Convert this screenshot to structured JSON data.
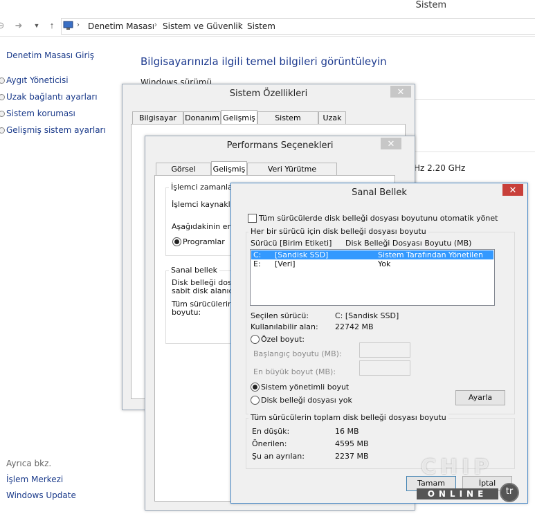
{
  "window": {
    "title": "Sistem"
  },
  "nav": {
    "back_icon": "back-arrow-icon",
    "forward_icon": "forward-arrow-icon",
    "breadcrumb": [
      "Denetim Masası",
      "Sistem ve Güvenlik",
      "Sistem"
    ]
  },
  "sidebar": {
    "home": "Denetim Masası Giriş",
    "items": [
      "Aygıt Yöneticisi",
      "Uzak bağlantı ayarları",
      "Sistem koruması",
      "Gelişmiş sistem ayarları"
    ],
    "see_also": "Ayrıca bkz.",
    "see_also_items": [
      "İşlem Merkezi",
      "Windows Update"
    ]
  },
  "main": {
    "heading": "Bilgisayarınızla ilgili temel bilgileri görüntüleyin",
    "windows_edition": "Windows sürümü",
    "cpu_speed": "Hz  2.20 GHz"
  },
  "sysprops": {
    "title": "Sistem Özellikleri",
    "close": "✕",
    "tabs": [
      "Bilgisayar Adı",
      "Donanım",
      "Gelişmiş",
      "Sistem Koruması",
      "Uzak"
    ],
    "active_tab": 2
  },
  "perf": {
    "title": "Performans Seçenekleri",
    "close": "✕",
    "tabs": [
      "Görsel Efektler",
      "Gelişmiş",
      "Veri Yürütme Engellemesi"
    ],
    "active_tab": 1,
    "sched_group": "İşlemci zamanlama",
    "sched_desc": "İşlemci kaynakların",
    "sched_best": "Aşağıdakinin en iy",
    "programs": "Programlar",
    "vm_group": "Sanal bellek",
    "vm_desc1": "Disk belleği dosyas",
    "vm_desc2": "sabit disk alanıdır.",
    "vm_desc3": "Tüm sürücülerin to",
    "vm_desc4": "boyutu:"
  },
  "vmem": {
    "title": "Sanal Bellek",
    "close": "✕",
    "auto_manage": "Tüm sürücülerde disk belleği dosyası boyutunu otomatik yönet",
    "per_drive_group": "Her bir sürücü için disk belleği dosyası boyutu",
    "col_drive": "Sürücü  [Birim Etiketi]",
    "col_size": "Disk Belleği Dosyası Boyutu (MB)",
    "drives": [
      {
        "letter": "C:",
        "label": "[Sandisk SSD]",
        "size": "Sistem Tarafından Yönetilen"
      },
      {
        "letter": "E:",
        "label": "[Veri]",
        "size": "Yok"
      }
    ],
    "selected_drive_label": "Seçilen sürücü:",
    "selected_drive_value": "C:  [Sandisk SSD]",
    "free_space_label": "Kullanılabilir alan:",
    "free_space_value": "22742 MB",
    "custom_size": "Özel boyut:",
    "initial_size": "Başlangıç boyutu (MB):",
    "max_size": "En büyük boyut (MB):",
    "system_managed": "Sistem yönetimli boyut",
    "no_paging": "Disk belleği dosyası yok",
    "set_button": "Ayarla",
    "total_group": "Tüm sürücülerin toplam disk belleği dosyası boyutu",
    "min_label": "En düşük:",
    "min_value": "16 MB",
    "rec_label": "Önerilen:",
    "rec_value": "4595 MB",
    "cur_label": "Şu an ayrılan:",
    "cur_value": "2237 MB",
    "ok_button": "Tamam",
    "cancel_button": "İptal"
  },
  "watermark": {
    "top": "CHIP",
    "bottom": "ONLINE",
    "badge": "tr"
  }
}
